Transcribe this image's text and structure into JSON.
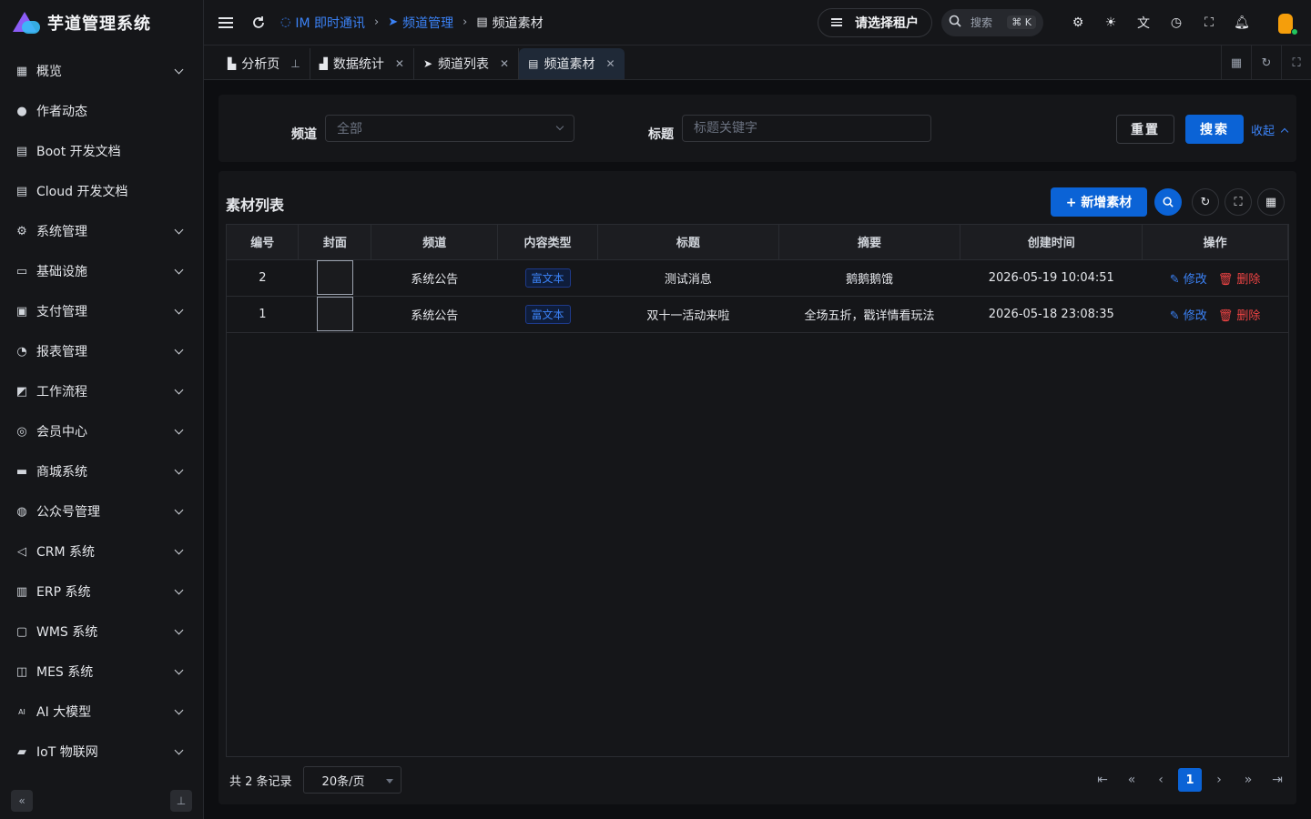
{
  "app": {
    "title": "芋道管理系统"
  },
  "sidebar": {
    "items": [
      {
        "icon": "grid-icon",
        "glyph": "▦",
        "label": "概览",
        "expandable": true
      },
      {
        "icon": "person-icon",
        "glyph": "●",
        "label": "作者动态",
        "expandable": false
      },
      {
        "icon": "doc-icon",
        "glyph": "▤",
        "label": "Boot 开发文档",
        "expandable": false
      },
      {
        "icon": "doc-copy-icon",
        "glyph": "▤",
        "label": "Cloud 开发文档",
        "expandable": false
      },
      {
        "icon": "gear-icon",
        "glyph": "⚙",
        "label": "系统管理",
        "expandable": true
      },
      {
        "icon": "monitor-icon",
        "glyph": "▭",
        "label": "基础设施",
        "expandable": true
      },
      {
        "icon": "payment-icon",
        "glyph": "▣",
        "label": "支付管理",
        "expandable": true
      },
      {
        "icon": "pie-chart-icon",
        "glyph": "◔",
        "label": "报表管理",
        "expandable": true
      },
      {
        "icon": "workflow-icon",
        "glyph": "◩",
        "label": "工作流程",
        "expandable": true
      },
      {
        "icon": "members-icon",
        "glyph": "◎",
        "label": "会员中心",
        "expandable": true
      },
      {
        "icon": "shop-icon",
        "glyph": "▬",
        "label": "商城系统",
        "expandable": true
      },
      {
        "icon": "compass-icon",
        "glyph": "◍",
        "label": "公众号管理",
        "expandable": true
      },
      {
        "icon": "crm-icon",
        "glyph": "◁",
        "label": "CRM 系统",
        "expandable": true
      },
      {
        "icon": "erp-icon",
        "glyph": "▥",
        "label": "ERP 系统",
        "expandable": true
      },
      {
        "icon": "warehouse-icon",
        "glyph": "▢",
        "label": "WMS 系统",
        "expandable": true
      },
      {
        "icon": "chip-icon",
        "glyph": "◫",
        "label": "MES 系统",
        "expandable": true
      },
      {
        "icon": "ai-icon",
        "glyph": "AI",
        "label": "AI 大模型",
        "expandable": true
      },
      {
        "icon": "iot-icon",
        "glyph": "▰",
        "label": "IoT 物联网",
        "expandable": true
      }
    ]
  },
  "header": {
    "breadcrumb": [
      {
        "icon": "chat-icon",
        "glyph": "◌",
        "label": "IM 即时通讯"
      },
      {
        "icon": "send-icon",
        "glyph": "➤",
        "label": "频道管理"
      },
      {
        "icon": "doc-icon",
        "glyph": "▤",
        "label": "频道素材"
      }
    ],
    "tenant_label": "请选择租户",
    "search_placeholder": "搜索",
    "search_shortcut": "⌘ K"
  },
  "tabs": [
    {
      "icon": "chart-icon",
      "glyph": "▙",
      "label": "分析页",
      "pinned": true
    },
    {
      "icon": "area-chart-icon",
      "glyph": "▟",
      "label": "数据统计",
      "pinned": false
    },
    {
      "icon": "send-icon",
      "glyph": "➤",
      "label": "频道列表",
      "pinned": false
    },
    {
      "icon": "doc-icon",
      "glyph": "▤",
      "label": "频道素材",
      "pinned": false,
      "active": true
    }
  ],
  "filter": {
    "channel_label": "频道",
    "channel_value": "全部",
    "title_label": "标题",
    "title_placeholder": "标题关键字",
    "reset_label": "重置",
    "search_label": "搜索",
    "collapse_label": "收起"
  },
  "table": {
    "title": "素材列表",
    "add_label": "+ 新增素材",
    "columns": [
      "编号",
      "封面",
      "频道",
      "内容类型",
      "标题",
      "摘要",
      "创建时间",
      "操作"
    ],
    "rows": [
      {
        "id": "2",
        "channel": "系统公告",
        "type": "富文本",
        "title": "测试消息",
        "summary": "鹅鹅鹅饿",
        "created": "2026-05-19 10:04:51"
      },
      {
        "id": "1",
        "channel": "系统公告",
        "type": "富文本",
        "title": "双十一活动来啦",
        "summary": "全场五折，戳详情看玩法",
        "created": "2026-05-18 23:08:35"
      }
    ],
    "edit_label": "修改",
    "delete_label": "删除",
    "total_text": "共 2 条记录",
    "page_size": "20条/页",
    "current_page": "1"
  },
  "colors": {
    "primary": "#0b63d6",
    "link": "#3b82f6",
    "danger": "#ef4444",
    "bg": "#0d0e11",
    "panel": "#151619"
  }
}
